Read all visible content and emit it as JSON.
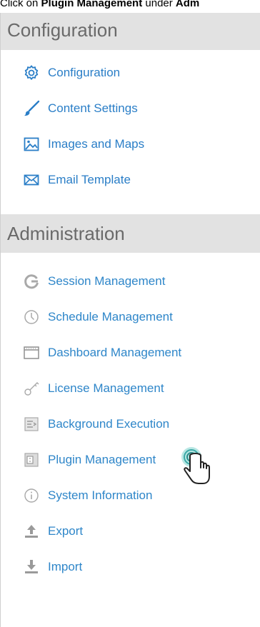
{
  "caption": {
    "prefix": "Click on ",
    "bold1": "Plugin Management",
    "middle": " under ",
    "bold2": "Adm"
  },
  "configuration": {
    "title": "Configuration",
    "items": [
      {
        "label": "Configuration",
        "icon": "gear-icon"
      },
      {
        "label": "Content Settings",
        "icon": "brush-icon"
      },
      {
        "label": "Images and Maps",
        "icon": "image-icon"
      },
      {
        "label": "Email Template",
        "icon": "envelope-icon"
      }
    ]
  },
  "administration": {
    "title": "Administration",
    "items": [
      {
        "label": "Session Management",
        "icon": "session-icon"
      },
      {
        "label": "Schedule Management",
        "icon": "clock-icon"
      },
      {
        "label": "Dashboard Management",
        "icon": "dashboard-icon"
      },
      {
        "label": "License Management",
        "icon": "key-icon"
      },
      {
        "label": "Background Execution",
        "icon": "background-execution-icon"
      },
      {
        "label": "Plugin Management",
        "icon": "plugin-icon"
      },
      {
        "label": "System Information",
        "icon": "info-icon"
      },
      {
        "label": "Export",
        "icon": "export-icon"
      },
      {
        "label": "Import",
        "icon": "import-icon"
      }
    ]
  },
  "colors": {
    "link_blue": "#2a7ec7",
    "header_bg": "#e2e2e2",
    "icon_gray": "#a9a9a9"
  }
}
